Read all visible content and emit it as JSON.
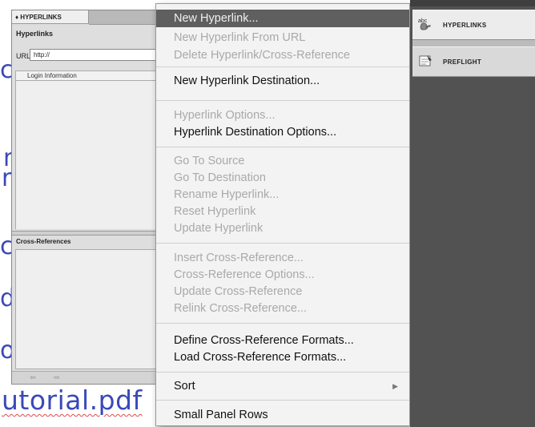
{
  "document": {
    "fragments": [
      "c",
      "n",
      "r",
      "c",
      "d",
      "o"
    ],
    "tutorial_text": "utorial.pdf"
  },
  "panel": {
    "tab_label": "♦ HYPERLINKS",
    "title": "Hyperlinks",
    "url_label": "URL:",
    "url_value": "http://",
    "list_header": "Login Information",
    "xref_title": "Cross-References"
  },
  "menu": {
    "items": [
      {
        "label": "New Hyperlink...",
        "state": "selected"
      },
      {
        "label": "New Hyperlink From URL",
        "state": "disabled"
      },
      {
        "label": "Delete Hyperlink/Cross-Reference",
        "state": "disabled"
      },
      {
        "label": "New Hyperlink Destination...",
        "state": "enabled"
      },
      {
        "label": "Hyperlink Options...",
        "state": "disabled"
      },
      {
        "label": "Hyperlink Destination Options...",
        "state": "enabled"
      },
      {
        "label": "Go To Source",
        "state": "disabled"
      },
      {
        "label": "Go To Destination",
        "state": "disabled"
      },
      {
        "label": "Rename Hyperlink...",
        "state": "disabled"
      },
      {
        "label": "Reset Hyperlink",
        "state": "disabled"
      },
      {
        "label": "Update Hyperlink",
        "state": "disabled"
      },
      {
        "label": "Insert Cross-Reference...",
        "state": "disabled"
      },
      {
        "label": "Cross-Reference Options...",
        "state": "disabled"
      },
      {
        "label": "Update Cross-Reference",
        "state": "disabled"
      },
      {
        "label": "Relink Cross-Reference...",
        "state": "disabled"
      },
      {
        "label": "Define Cross-Reference Formats...",
        "state": "enabled"
      },
      {
        "label": "Load Cross-Reference Formats...",
        "state": "enabled"
      },
      {
        "label": "Sort",
        "state": "enabled",
        "submenu": true
      },
      {
        "label": "Small Panel Rows",
        "state": "enabled"
      }
    ]
  },
  "dock": {
    "hyperlinks_label": "HYPERLINKS",
    "preflight_label": "PREFLIGHT"
  },
  "colors": {
    "menu_highlight": "#5f5f5f",
    "link_blue": "#3a49b8",
    "dock_bg": "#525252"
  }
}
